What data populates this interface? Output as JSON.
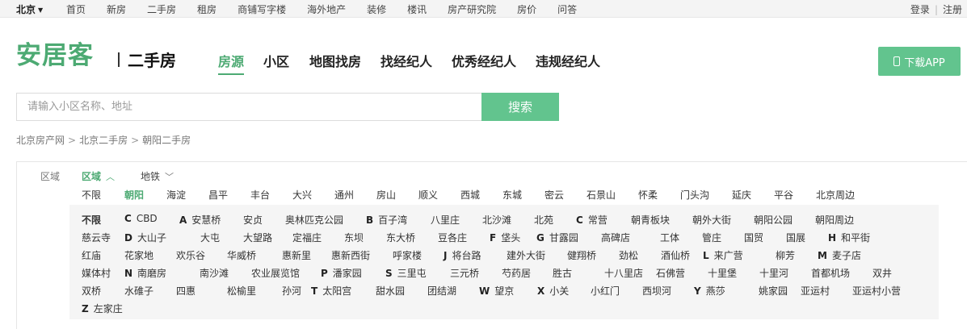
{
  "topbar": {
    "city": "北京",
    "nav": [
      "首页",
      "新房",
      "二手房",
      "租房",
      "商铺写字楼",
      "海外地产",
      "装修",
      "楼讯",
      "房产研究院",
      "房价",
      "问答"
    ],
    "login": "登录",
    "register": "注册"
  },
  "header": {
    "logo": "安居客",
    "subtitle": "二手房",
    "nav": [
      "房源",
      "小区",
      "地图找房",
      "找经纪人",
      "优秀经纪人",
      "违规经纪人"
    ],
    "download_label": "下载APP"
  },
  "search": {
    "placeholder": "请输入小区名称、地址",
    "button_label": "搜索"
  },
  "breadcrumb": [
    "北京房产网",
    "北京二手房",
    "朝阳二手房"
  ],
  "filter": {
    "label": "区域",
    "tab_area": "区域",
    "tab_subway": "地铁",
    "districts": [
      "不限",
      "朝阳",
      "海淀",
      "昌平",
      "丰台",
      "大兴",
      "通州",
      "房山",
      "顺义",
      "西城",
      "东城",
      "密云",
      "石景山",
      "怀柔",
      "门头沟",
      "延庆",
      "平谷",
      "北京周边"
    ],
    "sub_rows": [
      [
        {
          "l": "",
          "t": "不限"
        },
        {
          "l": "C",
          "t": "CBD"
        },
        {
          "l": "A",
          "t": "安慧桥"
        },
        {
          "l": "",
          "t": "安贞"
        },
        {
          "l": "",
          "t": "奥林匹克公园"
        },
        {
          "l": "B",
          "t": "百子湾"
        },
        {
          "l": "",
          "t": "八里庄"
        },
        {
          "l": "",
          "t": "北沙滩"
        },
        {
          "l": "",
          "t": "北苑"
        },
        {
          "l": "C",
          "t": "常营"
        },
        {
          "l": "",
          "t": "朝青板块"
        },
        {
          "l": "",
          "t": "朝外大街"
        },
        {
          "l": "",
          "t": "朝阳公园"
        },
        {
          "l": "",
          "t": "朝阳周边"
        }
      ],
      [
        {
          "l": "",
          "t": "慈云寺"
        },
        {
          "l": "D",
          "t": "大山子"
        },
        {
          "l": "",
          "t": "大屯"
        },
        {
          "l": "",
          "t": "大望路"
        },
        {
          "l": "",
          "t": "定福庄"
        },
        {
          "l": "",
          "t": "东坝"
        },
        {
          "l": "",
          "t": "东大桥"
        },
        {
          "l": "",
          "t": "豆各庄"
        },
        {
          "l": "F",
          "t": "垡头"
        },
        {
          "l": "G",
          "t": "甘露园"
        },
        {
          "l": "",
          "t": "高碑店"
        },
        {
          "l": "",
          "t": "工体"
        },
        {
          "l": "",
          "t": "管庄"
        },
        {
          "l": "",
          "t": "国贸"
        },
        {
          "l": "",
          "t": "国展"
        },
        {
          "l": "H",
          "t": "和平街"
        }
      ],
      [
        {
          "l": "",
          "t": "红庙"
        },
        {
          "l": "",
          "t": "花家地"
        },
        {
          "l": "",
          "t": "欢乐谷"
        },
        {
          "l": "",
          "t": "华威桥"
        },
        {
          "l": "",
          "t": "惠新里"
        },
        {
          "l": "",
          "t": "惠新西街"
        },
        {
          "l": "",
          "t": "呼家楼"
        },
        {
          "l": "J",
          "t": "将台路"
        },
        {
          "l": "",
          "t": "建外大街"
        },
        {
          "l": "",
          "t": "健翔桥"
        },
        {
          "l": "",
          "t": "劲松"
        },
        {
          "l": "",
          "t": "酒仙桥"
        },
        {
          "l": "L",
          "t": "来广营"
        },
        {
          "l": "",
          "t": "柳芳"
        },
        {
          "l": "M",
          "t": "麦子店"
        }
      ],
      [
        {
          "l": "",
          "t": "媒体村"
        },
        {
          "l": "N",
          "t": "南磨房"
        },
        {
          "l": "",
          "t": "南沙滩"
        },
        {
          "l": "",
          "t": "农业展览馆"
        },
        {
          "l": "P",
          "t": "潘家园"
        },
        {
          "l": "S",
          "t": "三里屯"
        },
        {
          "l": "",
          "t": "三元桥"
        },
        {
          "l": "",
          "t": "芍药居"
        },
        {
          "l": "",
          "t": "胜古"
        },
        {
          "l": "",
          "t": "十八里店"
        },
        {
          "l": "",
          "t": "石佛营"
        },
        {
          "l": "",
          "t": "十里堡"
        },
        {
          "l": "",
          "t": "十里河"
        },
        {
          "l": "",
          "t": "首都机场"
        },
        {
          "l": "",
          "t": "双井"
        }
      ],
      [
        {
          "l": "",
          "t": "双桥"
        },
        {
          "l": "",
          "t": "水碓子"
        },
        {
          "l": "",
          "t": "四惠"
        },
        {
          "l": "",
          "t": "松榆里"
        },
        {
          "l": "",
          "t": "孙河"
        },
        {
          "l": "T",
          "t": "太阳宫"
        },
        {
          "l": "",
          "t": "甜水园"
        },
        {
          "l": "",
          "t": "团结湖"
        },
        {
          "l": "W",
          "t": "望京"
        },
        {
          "l": "X",
          "t": "小关"
        },
        {
          "l": "",
          "t": "小红门"
        },
        {
          "l": "",
          "t": "西坝河"
        },
        {
          "l": "Y",
          "t": "燕莎"
        },
        {
          "l": "",
          "t": "姚家园"
        },
        {
          "l": "",
          "t": "亚运村"
        },
        {
          "l": "",
          "t": "亚运村小营"
        }
      ],
      [
        {
          "l": "Z",
          "t": "左家庄"
        }
      ]
    ]
  },
  "colors": {
    "accent": "#4daa73",
    "button": "#62c48e"
  }
}
